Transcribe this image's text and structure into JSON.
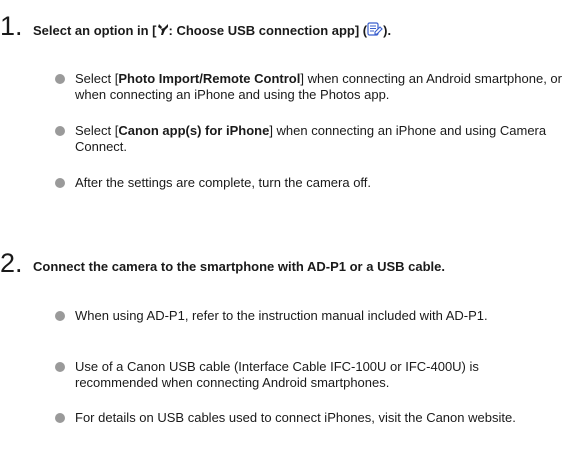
{
  "step1": {
    "number": "1.",
    "title": {
      "prefix": "Select an option in [",
      "menu": ": Choose USB connection app] (",
      "suffix": ")."
    },
    "bullets": [
      {
        "pre": "Select [",
        "bold": "Photo Import/Remote Control",
        "post": "] when connecting an Android smartphone, or when connecting an iPhone and using the Photos app."
      },
      {
        "pre": "Select [",
        "bold": "Canon app(s) for iPhone",
        "post": "] when connecting an iPhone and using Camera Connect."
      },
      {
        "pre": "After the settings are complete, turn the camera off.",
        "bold": "",
        "post": ""
      }
    ]
  },
  "step2": {
    "number": "2.",
    "title": "Connect the camera to the smartphone with AD-P1 or a USB cable.",
    "bullets": [
      "When using AD-P1, refer to the instruction manual included with AD-P1.",
      "Use of a Canon USB cable (Interface Cable IFC-100U or IFC-400U) is recommended when connecting Android smartphones.",
      "For details on USB cables used to connect iPhones, visit the Canon website."
    ]
  },
  "icons": {
    "menu_icon": "wrench-icon",
    "ref_icon": "page-reference-icon",
    "bullet_color": "#9a9a9a",
    "accent": "#1a1a1a"
  }
}
